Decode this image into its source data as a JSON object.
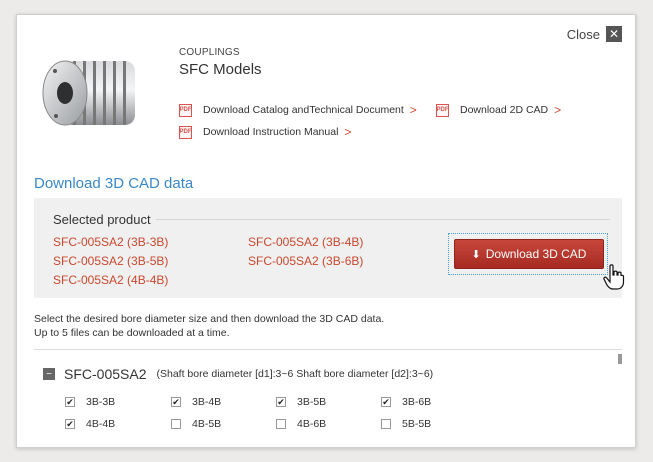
{
  "close_label": "Close",
  "header": {
    "category": "COUPLINGS",
    "title": "SFC Models",
    "pdf_badge": "PDF",
    "links": [
      {
        "label": "Download Catalog andTechnical Document",
        "icon": "pdf-icon"
      },
      {
        "label": "Download 2D CAD",
        "icon": "pdf-icon"
      },
      {
        "label": "Download Instruction Manual",
        "icon": "pdf-icon"
      }
    ],
    "link_chevron": ">"
  },
  "section_title": "Download 3D CAD data",
  "selected": {
    "label": "Selected product",
    "items": [
      "SFC-005SA2 (3B-3B)",
      "SFC-005SA2 (3B-4B)",
      "SFC-005SA2 (3B-5B)",
      "SFC-005SA2 (3B-6B)",
      "SFC-005SA2 (4B-4B)"
    ],
    "download_button": "Download 3D CAD"
  },
  "note": {
    "line1": "Select the desired bore diameter size and then download the 3D CAD data.",
    "line2": "Up to 5 files can be downloaded at a time."
  },
  "group": {
    "collapse_symbol": "−",
    "name": "SFC-005SA2",
    "description": "(Shaft bore diameter [d1]:3~6 Shaft bore diameter [d2]:3~6)",
    "options": [
      {
        "label": "3B-3B",
        "checked": true
      },
      {
        "label": "3B-4B",
        "checked": true
      },
      {
        "label": "3B-5B",
        "checked": true
      },
      {
        "label": "3B-6B",
        "checked": true
      },
      {
        "label": "4B-4B",
        "checked": true
      },
      {
        "label": "4B-5B",
        "checked": false
      },
      {
        "label": "4B-6B",
        "checked": false
      },
      {
        "label": "5B-5B",
        "checked": false
      }
    ]
  },
  "colors": {
    "accent_blue": "#3a87c8",
    "link_red": "#c9482e",
    "button_red": "#b8362d"
  }
}
